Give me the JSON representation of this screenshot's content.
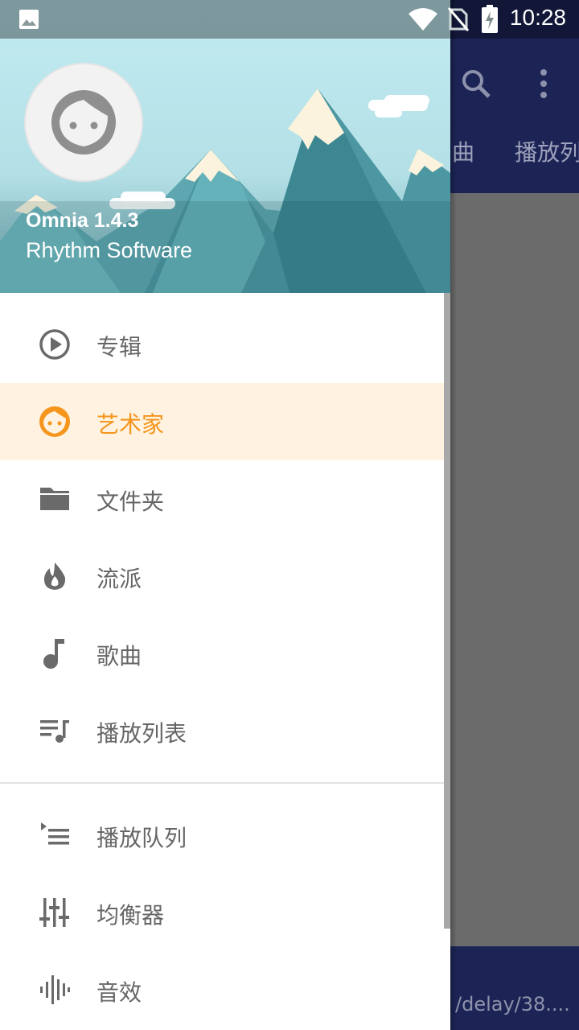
{
  "status_bar": {
    "time": "10:28",
    "icons": [
      "image-icon",
      "wifi-icon",
      "no-sim-icon",
      "battery-charging-icon"
    ]
  },
  "background_app": {
    "toolbar_icons": [
      "search-icon",
      "more-vert-icon"
    ],
    "tabs": [
      "曲",
      "播放列"
    ],
    "bottom_text": "/delay/38...."
  },
  "drawer": {
    "header": {
      "app_name": "Omnia 1.4.3",
      "developer": "Rhythm Software"
    },
    "items": [
      {
        "label": "专辑",
        "icon": "play-circle-icon",
        "active": false
      },
      {
        "label": "艺术家",
        "icon": "face-icon",
        "active": true
      },
      {
        "label": "文件夹",
        "icon": "folder-icon",
        "active": false
      },
      {
        "label": "流派",
        "icon": "flame-icon",
        "active": false
      },
      {
        "label": "歌曲",
        "icon": "music-note-icon",
        "active": false
      },
      {
        "label": "播放列表",
        "icon": "playlist-icon",
        "active": false
      },
      {
        "label": "播放队列",
        "icon": "queue-icon",
        "active": false
      },
      {
        "label": "均衡器",
        "icon": "equalizer-icon",
        "active": false
      },
      {
        "label": "音效",
        "icon": "sound-wave-icon",
        "active": false
      }
    ]
  },
  "colors": {
    "accent": "#f5951c",
    "active_bg": "#fff2e0",
    "toolbar": "#1c2456",
    "icon_grey": "#666666"
  }
}
